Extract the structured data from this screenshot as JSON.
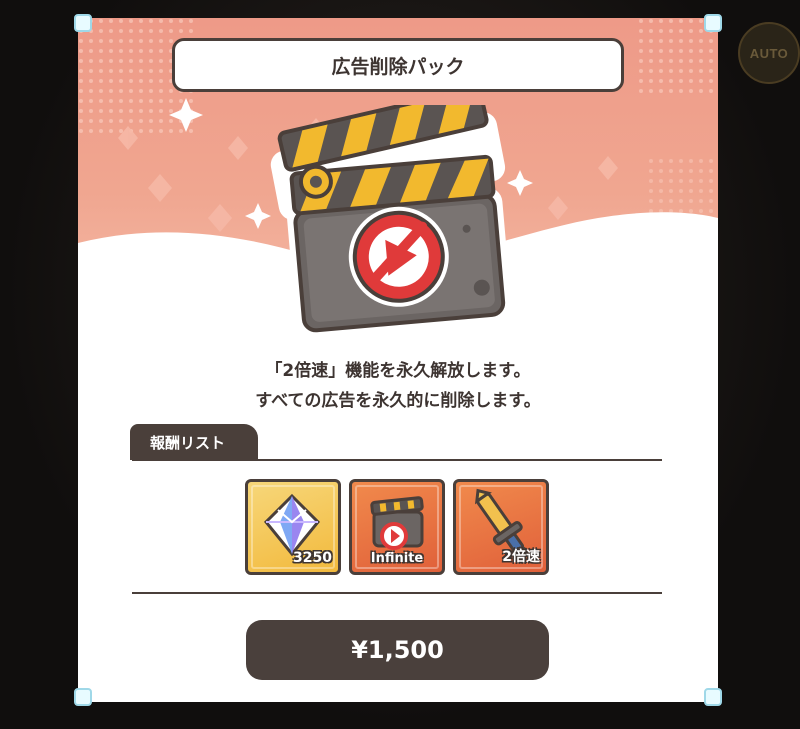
{
  "hud": {
    "auto_label": "AUTO"
  },
  "dialog": {
    "title": "広告削除パック",
    "description_line1": "「2倍速」機能を永久解放します。",
    "description_line2": "すべての広告を永久的に削除します。",
    "rewards_tab": "報酬リスト",
    "rewards": [
      {
        "icon": "crystal-icon",
        "label": "3250",
        "color": "#f4c24e"
      },
      {
        "icon": "clapperboard-icon",
        "label": "Infinite",
        "color": "#e8703e"
      },
      {
        "icon": "speed-sword-icon",
        "label": "2倍速",
        "color": "#e8703e"
      }
    ],
    "price": "¥1,500"
  },
  "colors": {
    "header_pink": "#ee9a88",
    "dark_brown": "#4a3f3a",
    "accent_red": "#e03a3a",
    "stripe_yellow": "#f2b92e"
  }
}
